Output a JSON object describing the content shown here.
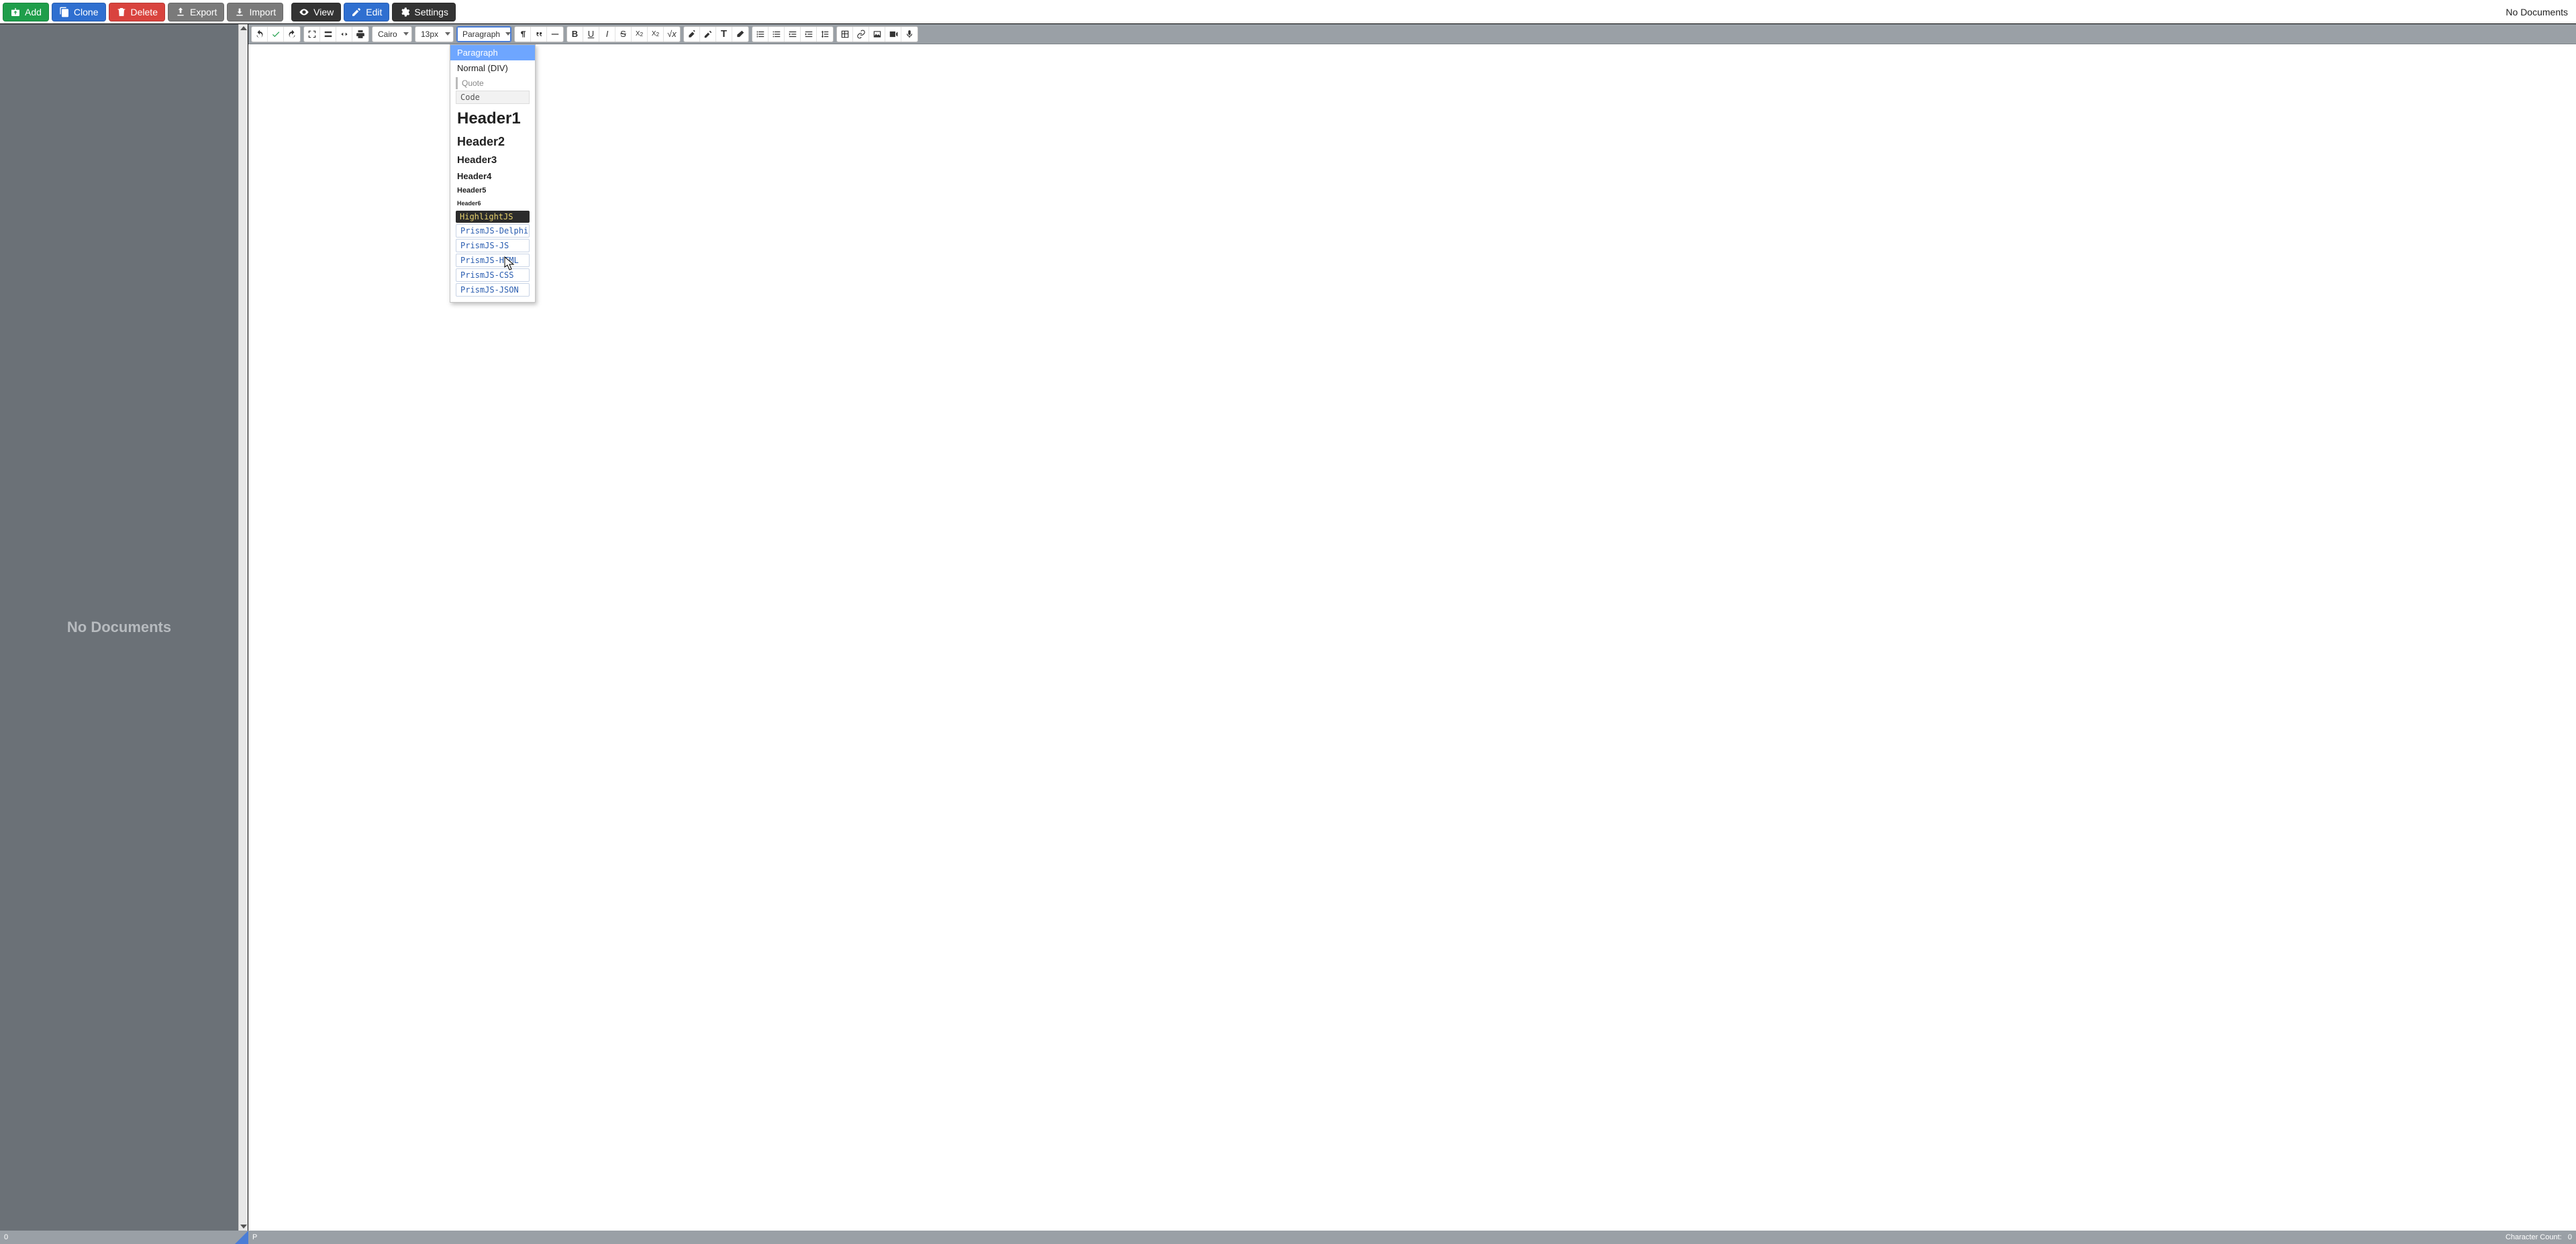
{
  "topbar": {
    "add": "Add",
    "clone": "Clone",
    "delete": "Delete",
    "export": "Export",
    "import": "Import",
    "view": "View",
    "edit": "Edit",
    "settings": "Settings",
    "right_status": "No Documents"
  },
  "sidepanel": {
    "empty_text": "No Documents"
  },
  "toolbar": {
    "font": "Cairo",
    "size": "13px",
    "block": "Paragraph"
  },
  "dropdown": {
    "items": [
      {
        "label": "Paragraph",
        "style": "selected"
      },
      {
        "label": "Normal (DIV)",
        "style": ""
      },
      {
        "label": "Quote",
        "style": "quote"
      },
      {
        "label": "Code",
        "style": "code"
      },
      {
        "label": "Header1",
        "style": "h1"
      },
      {
        "label": "Header2",
        "style": "h2"
      },
      {
        "label": "Header3",
        "style": "h3"
      },
      {
        "label": "Header4",
        "style": "h4"
      },
      {
        "label": "Header5",
        "style": "h5"
      },
      {
        "label": "Header6",
        "style": "h6"
      },
      {
        "label": "HighlightJS",
        "style": "hljs"
      },
      {
        "label": "PrismJS-Delphi",
        "style": "prism hover"
      },
      {
        "label": "PrismJS-JS",
        "style": "prism"
      },
      {
        "label": "PrismJS-HTML",
        "style": "prism"
      },
      {
        "label": "PrismJS-CSS",
        "style": "prism"
      },
      {
        "label": "PrismJS-JSON",
        "style": "prism"
      }
    ]
  },
  "statusbar": {
    "left": "0",
    "path": "P",
    "cc_label": "Character Count:",
    "cc_value": "0"
  }
}
